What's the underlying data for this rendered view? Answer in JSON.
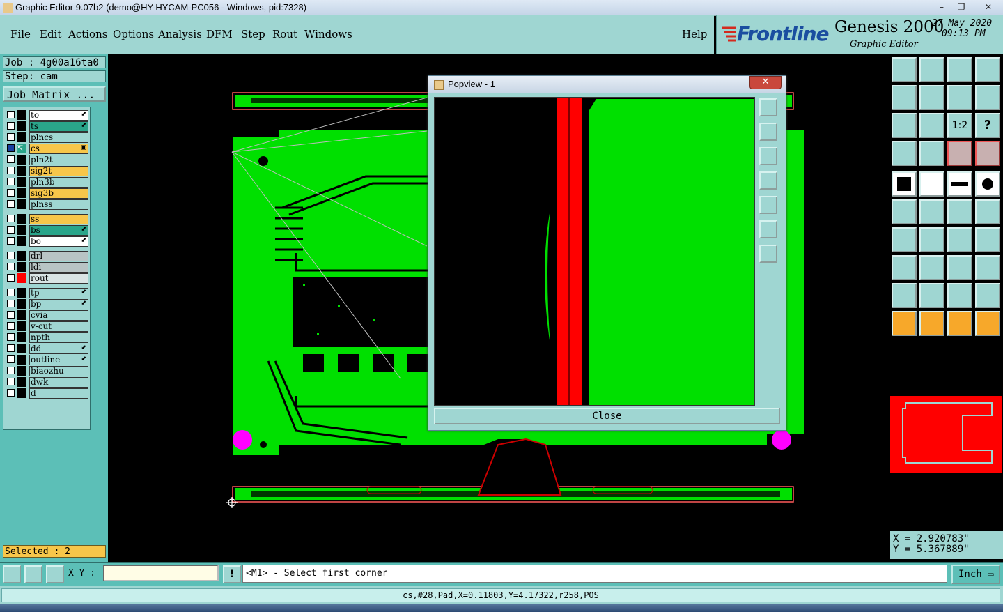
{
  "window": {
    "title": "Graphic Editor 9.07b2 (demo@HY-HYCAM-PC056 - Windows, pid:7328)",
    "min_label": "–",
    "max_label": "❐",
    "close_label": "✕"
  },
  "menu": {
    "items": [
      "File",
      "Edit",
      "Actions",
      "Options",
      "Analysis",
      "DFM",
      "Step",
      "Rout",
      "Windows"
    ],
    "help": "Help"
  },
  "brand": {
    "logo": "Frontline",
    "product": "Genesis 2000",
    "subtitle": "Graphic Editor",
    "date": "27 May 2020",
    "time": "09:13 PM"
  },
  "job": {
    "job_label": "Job : 4g00a16ta0",
    "step_label": "Step: cam",
    "matrix_button": "Job Matrix ..."
  },
  "layers": [
    {
      "name": "to",
      "color": "#ffffff",
      "mark": "⬋"
    },
    {
      "name": "ts",
      "color": "#2aa58a",
      "mark": "⬋"
    },
    {
      "name": "plncs",
      "color": "#9fd6d2",
      "mark": ""
    },
    {
      "name": "cs",
      "color": "#f7c64a",
      "mark": "▣",
      "active": true
    },
    {
      "name": "pln2t",
      "color": "#9fd6d2",
      "mark": ""
    },
    {
      "name": "sig2t",
      "color": "#f7c64a",
      "mark": ""
    },
    {
      "name": "pln3b",
      "color": "#9fd6d2",
      "mark": ""
    },
    {
      "name": "sig3b",
      "color": "#f7c64a",
      "mark": ""
    },
    {
      "name": "plnss",
      "color": "#9fd6d2",
      "mark": ""
    },
    {
      "name": "ss",
      "color": "#f7c64a",
      "mark": ""
    },
    {
      "name": "bs",
      "color": "#2aa58a",
      "mark": "⬋"
    },
    {
      "name": "bo",
      "color": "#ffffff",
      "mark": "⬋"
    },
    {
      "name": "drl",
      "color": "#b8c4c4",
      "mark": ""
    },
    {
      "name": "ldi",
      "color": "#b8c4c4",
      "mark": ""
    },
    {
      "name": "rout",
      "color": "#d9e4e4",
      "mark": "",
      "indicator": "#ff0000"
    },
    {
      "name": "tp",
      "color": "#9fd6d2",
      "mark": "⬋"
    },
    {
      "name": "bp",
      "color": "#9fd6d2",
      "mark": "⬋"
    },
    {
      "name": "cvia",
      "color": "#9fd6d2",
      "mark": ""
    },
    {
      "name": "v-cut",
      "color": "#9fd6d2",
      "mark": ""
    },
    {
      "name": "npth",
      "color": "#9fd6d2",
      "mark": ""
    },
    {
      "name": "dd",
      "color": "#9fd6d2",
      "mark": "⬋"
    },
    {
      "name": "outline",
      "color": "#9fd6d2",
      "mark": "⬋"
    },
    {
      "name": "biaozhu",
      "color": "#9fd6d2",
      "mark": ""
    },
    {
      "name": "dwk",
      "color": "#9fd6d2",
      "mark": ""
    },
    {
      "name": "d",
      "color": "#9fd6d2",
      "mark": ""
    }
  ],
  "selected": "Selected : 2",
  "popview": {
    "title": "Popview - 1",
    "close_x": "✕",
    "close_button": "Close"
  },
  "toolbar": {
    "one_to_two": "1:2",
    "help": "?"
  },
  "coords": {
    "x": "X = 2.920783\"",
    "y": "Y = 5.367889\""
  },
  "bottom": {
    "xy_label": "X Y :",
    "xy_value": "",
    "alert": "!",
    "prompt": "<M1> - Select first corner",
    "unit": "Inch"
  },
  "status": "cs,#28,Pad,X=0.11803,Y=4.17322,r258,POS",
  "colors": {
    "board": "#00e000",
    "accent": "#9fd6d2",
    "panel": "#5cbfb7",
    "highlight": "#ff0000",
    "marker": "#ff00ff"
  }
}
